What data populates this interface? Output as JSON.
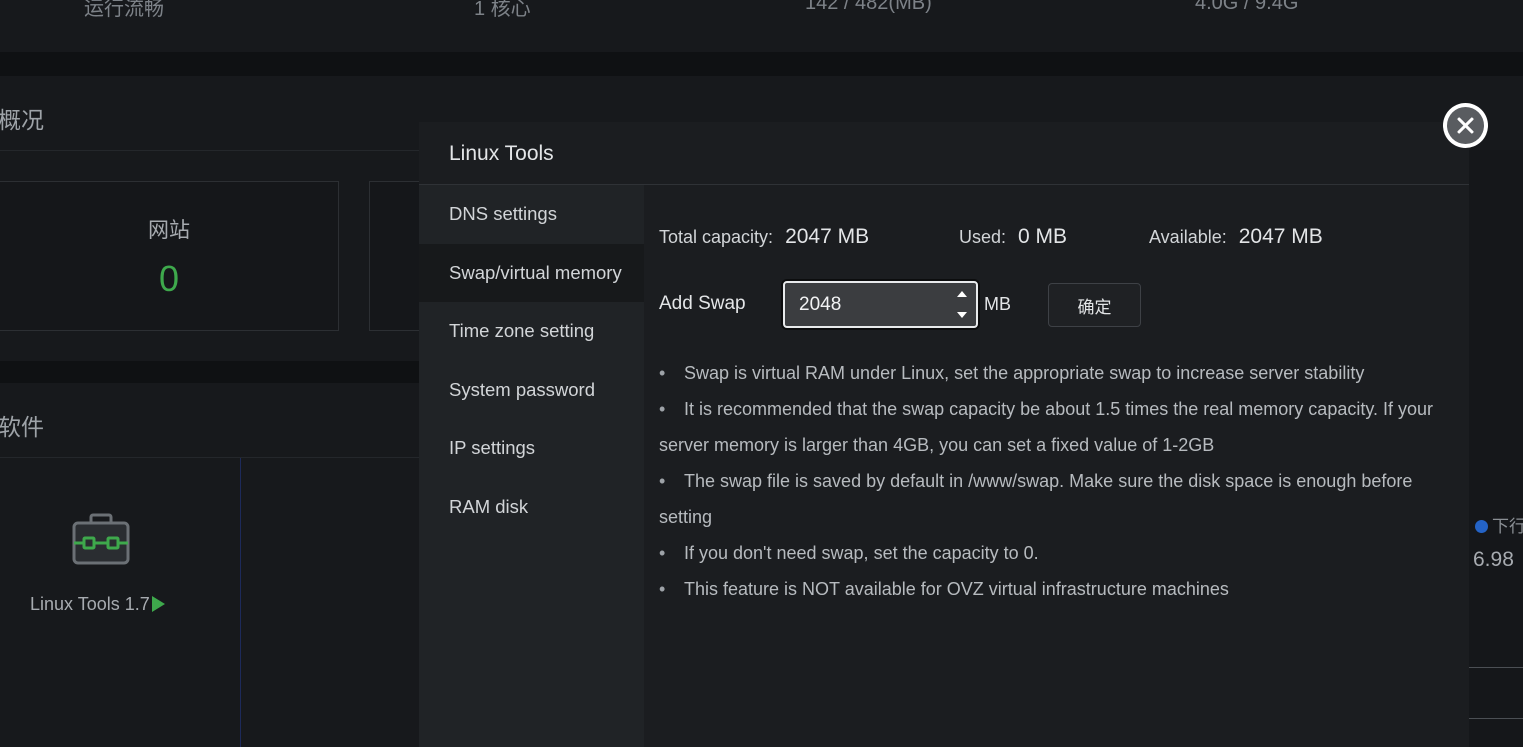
{
  "background": {
    "top_strip": [
      "运行流畅",
      "1 核心",
      "142 / 482(MB)",
      "4.0G / 9.4G"
    ],
    "overview_title": "概况",
    "site_card": {
      "label": "网站",
      "value": "0"
    },
    "software_title": "软件",
    "software_item_label": "Linux Tools 1.7",
    "right_legend": "下行",
    "right_value": "6.98"
  },
  "modal": {
    "title": "Linux Tools",
    "nav": [
      {
        "label": "DNS settings"
      },
      {
        "label": "Swap/virtual memory"
      },
      {
        "label": "Time zone setting"
      },
      {
        "label": "System password"
      },
      {
        "label": "IP settings"
      },
      {
        "label": "RAM disk"
      }
    ],
    "active_nav": "Swap/virtual memory",
    "stats": {
      "total_label": "Total capacity:",
      "total_value": "2047 MB",
      "used_label": "Used:",
      "used_value": "0 MB",
      "available_label": "Available:",
      "available_value": "2047 MB"
    },
    "add_swap": {
      "label": "Add Swap",
      "value": "2048",
      "unit": "MB",
      "confirm_label": "确定"
    },
    "tips": [
      "Swap is virtual RAM under Linux, set the appropriate swap to increase server stability",
      "It is recommended that the swap capacity be about 1.5 times the real memory capacity. If your server memory is larger than 4GB, you can set a fixed value of 1-2GB",
      "The swap file is saved by default in /www/swap. Make sure the disk space is enough before setting",
      "If you don't need swap, set the capacity to 0.",
      "This feature is NOT available for OVZ virtual infrastructure machines"
    ]
  },
  "colors": {
    "accent_green": "#3ea94c",
    "legend_blue": "#2463c6",
    "modal_bg": "#1b1d20",
    "page_bg": "#0f1113"
  },
  "icons": {
    "software_icon": "toolbox-icon",
    "close_icon": "close-icon",
    "run_icon": "play-icon"
  }
}
